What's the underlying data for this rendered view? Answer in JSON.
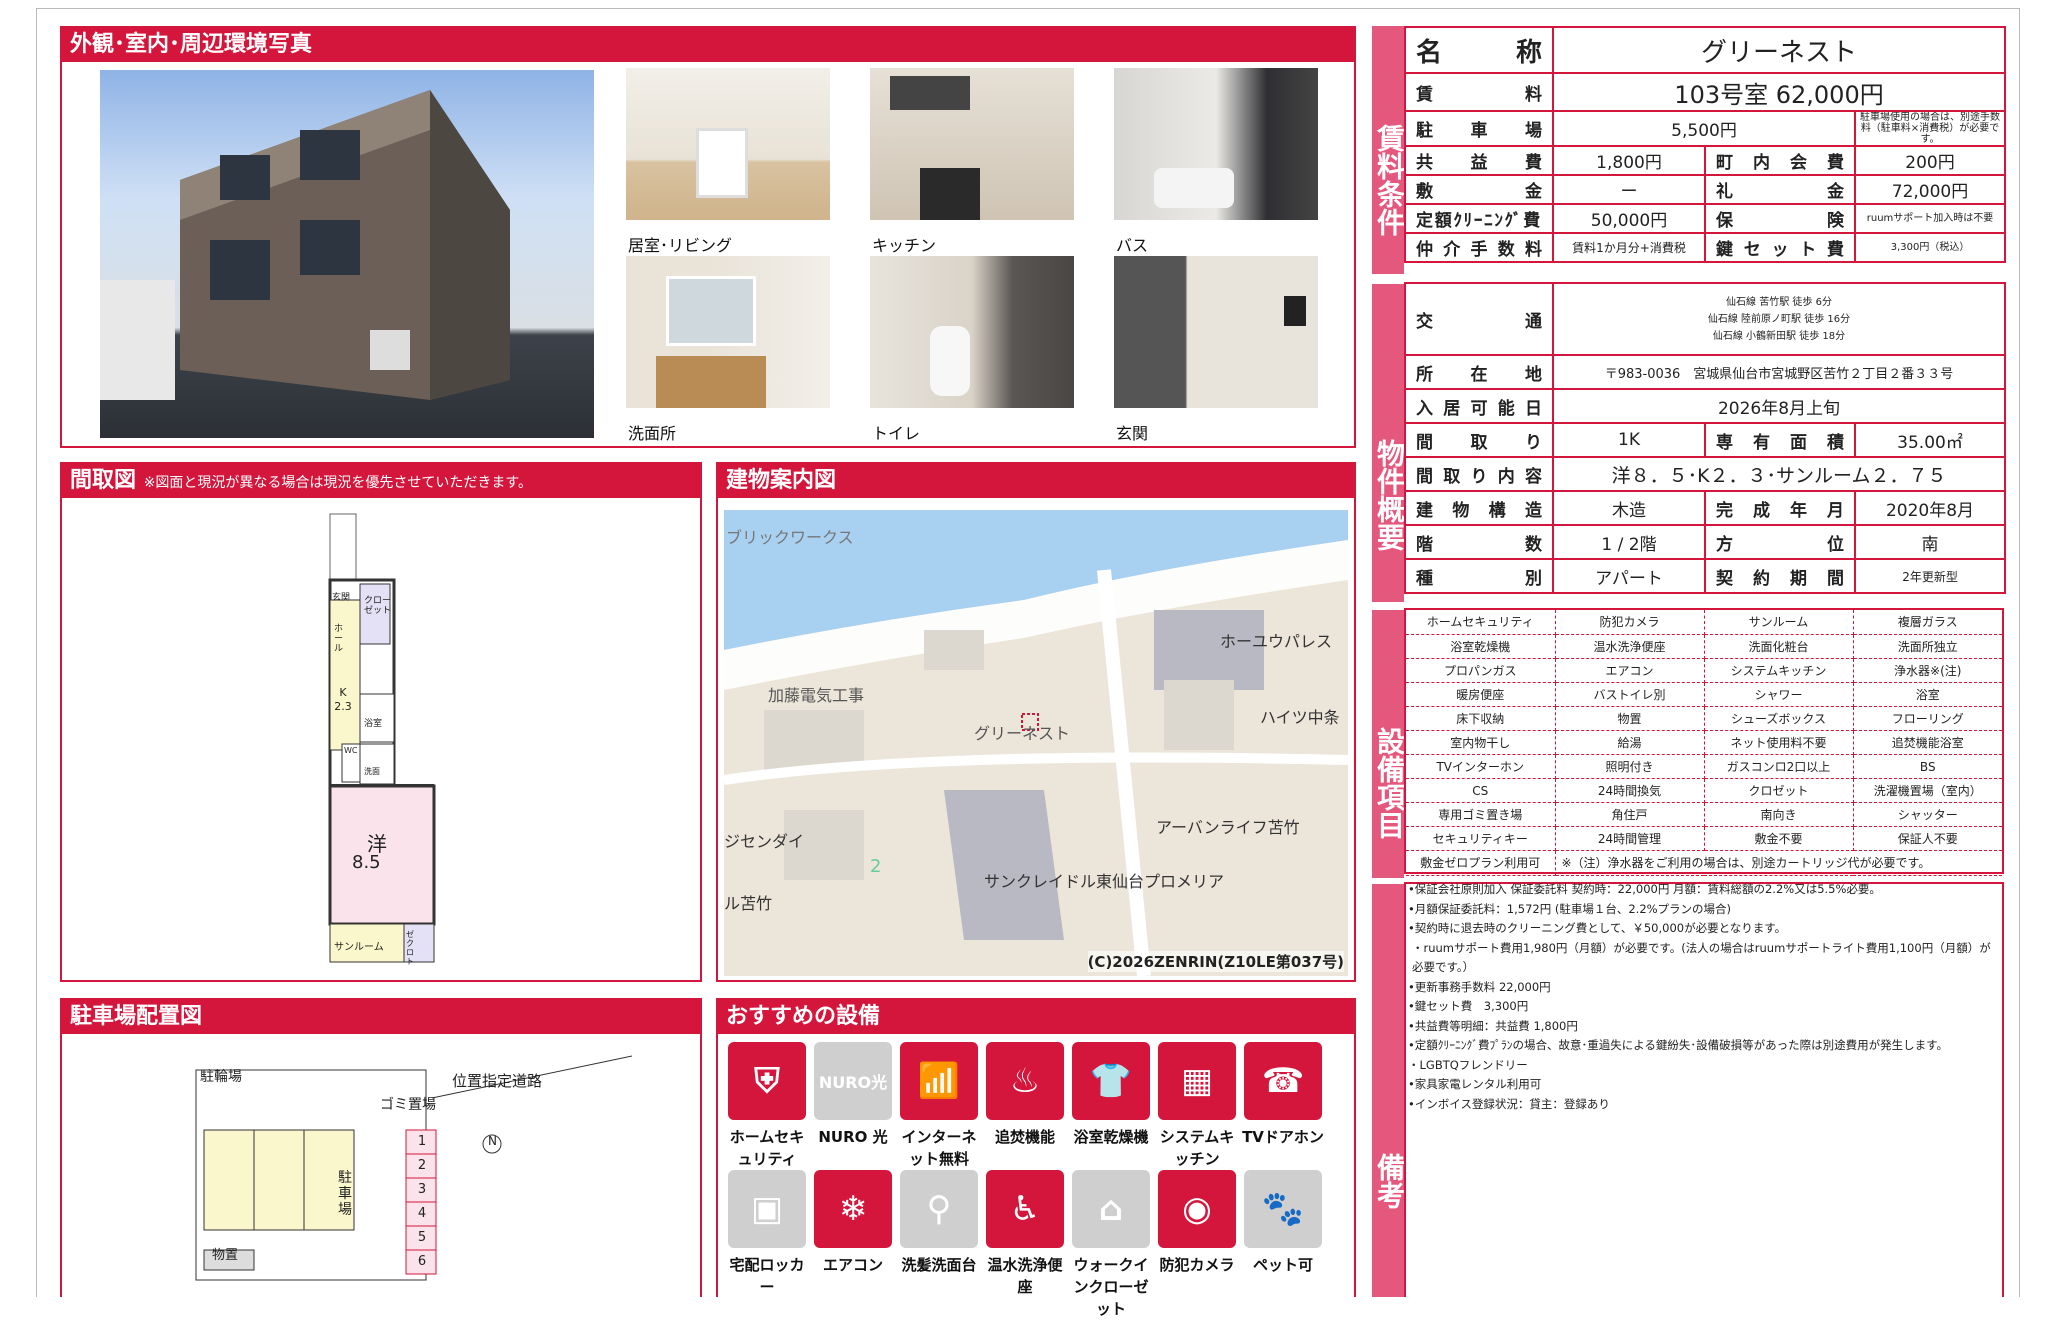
{
  "photos_panel": {
    "title": "外観･室内･周辺環境写真",
    "captions": [
      "居室･リビング",
      "キッチン",
      "バス",
      "洗面所",
      "トイレ",
      "玄関"
    ]
  },
  "floorplan_panel": {
    "title": "間取図",
    "note": "※図面と現況が異なる場合は現況を優先させていただきます。",
    "labels": {
      "entrance": "玄関",
      "closet": "クロー ゼット",
      "hall": "ホ ー ル",
      "kitchen": "K 2.3",
      "bath": "浴室",
      "wc": "WC",
      "washroom": "洗面",
      "room": "洋",
      "room_size": "8.5",
      "sunroom": "サンルーム",
      "small_closet": "ゼクロト"
    }
  },
  "map_panel": {
    "title": "建物案内図",
    "labels": [
      "ブリックワークス",
      "加藤電気工事",
      "グリーネスト",
      "ホーユウパレス",
      "ハイツ中条",
      "アーバンライフ苫竹",
      "ジセンダイ",
      "ル苫竹",
      "サンクレイドル東仙台プロメリア",
      "2"
    ],
    "copyright": "(C)2026ZENRIN(Z10LE第037号)"
  },
  "parking_panel": {
    "title": "駐車場配置図",
    "labels": {
      "bike": "駐輪場",
      "garbage": "ゴミ置場",
      "road": "位置指定道路",
      "parking": "駐 車 場",
      "storage": "物置",
      "north": "N"
    },
    "spaces": [
      "1",
      "2",
      "3",
      "4",
      "5",
      "6"
    ]
  },
  "recommend_panel": {
    "title": "おすすめの設備",
    "items": [
      {
        "label": "ホームセキュリティ",
        "icon": "shield-icon",
        "on": true
      },
      {
        "label": "NURO 光",
        "icon": "nuro-icon",
        "on": false
      },
      {
        "label": "インターネット無料",
        "icon": "wifi-icon",
        "on": true
      },
      {
        "label": "追焚機能",
        "icon": "bathtub-icon",
        "on": true
      },
      {
        "label": "浴室乾燥機",
        "icon": "bath-dryer-icon",
        "on": true
      },
      {
        "label": "システムキッチン",
        "icon": "kitchen-icon",
        "on": true
      },
      {
        "label": "TVドアホン",
        "icon": "tv-doorphone-icon",
        "on": true
      },
      {
        "label": "宅配ロッカー",
        "icon": "delivery-locker-icon",
        "on": false
      },
      {
        "label": "エアコン",
        "icon": "aircon-icon",
        "on": true
      },
      {
        "label": "洗髪洗面台",
        "icon": "vanity-icon",
        "on": false
      },
      {
        "label": "温水洗浄便座",
        "icon": "toilet-icon",
        "on": true
      },
      {
        "label": "ウォークインクローゼット",
        "icon": "closet-icon",
        "on": false
      },
      {
        "label": "防犯カメラ",
        "icon": "camera-icon",
        "on": true
      },
      {
        "label": "ペット可",
        "icon": "paw-icon",
        "on": false
      }
    ]
  },
  "sections": {
    "rent": "賃料条件",
    "property": "物件概要",
    "equipment": "設備項目",
    "remarks": "備考"
  },
  "rent": {
    "name_label": "名 称",
    "name": "グリーネスト",
    "rent_label": "賃 料",
    "rent": "103号室 62,000円",
    "parking_label": "駐 車 場",
    "parking": "5,500円",
    "parking_note": "駐車場使用の場合は、別途手数料（駐車料×消費税）が必要です。",
    "common_label": "共 益 費",
    "common": "1,800円",
    "town_label": "町 内 会 費",
    "town": "200円",
    "deposit_label": "敷 金",
    "deposit": "ー",
    "key_money_label": "礼 金",
    "key_money": "72,000円",
    "cleaning_label": "定額ｸﾘｰﾆﾝｸﾞ費",
    "cleaning": "50,000円",
    "insurance_label": "保 険",
    "insurance": "ruumサポート加入時は不要",
    "brokerage_label": "仲 介 手 数 料",
    "brokerage": "賃料1か月分+消費税",
    "keyset_label": "鍵 セ ッ ト 費",
    "keyset": "3,300円（税込）"
  },
  "property": {
    "transport_label": "交 通",
    "transport": [
      "仙石線 苦竹駅 徒歩 6分",
      "仙石線 陸前原ノ町駅 徒歩 16分",
      "仙石線 小鶴新田駅 徒歩 18分"
    ],
    "address_label": "所 在 地",
    "address": "〒983-0036　宮城県仙台市宮城野区苦竹２丁目２番３３号",
    "available_label": "入 居 可 能 日",
    "available": "2026年8月上旬",
    "layout_label": "間 取 り",
    "layout": "1K",
    "area_label": "専 有 面 積",
    "area": "35.00㎡",
    "detail_label": "間 取 り 内 容",
    "detail": "洋８．５･K２．３･サンルーム２．７５",
    "structure_label": "建 物 構 造",
    "structure": "木造",
    "built_label": "完 成 年 月",
    "built": "2020年8月",
    "floor_label": "階 数",
    "floor": "1 / 2階",
    "direction_label": "方 位",
    "direction": "南",
    "type_label": "種 別",
    "type": "アパート",
    "contract_label": "契 約 期 間",
    "contract": "2年更新型"
  },
  "equipment": [
    [
      "ホームセキュリティ",
      "防犯カメラ",
      "サンルーム",
      "複層ガラス"
    ],
    [
      "浴室乾燥機",
      "温水洗浄便座",
      "洗面化粧台",
      "洗面所独立"
    ],
    [
      "プロパンガス",
      "エアコン",
      "システムキッチン",
      "浄水器※(注)"
    ],
    [
      "暖房便座",
      "バストイレ別",
      "シャワー",
      "浴室"
    ],
    [
      "床下収納",
      "物置",
      "シューズボックス",
      "フローリング"
    ],
    [
      "室内物干し",
      "給湯",
      "ネット使用料不要",
      "追焚機能浴室"
    ],
    [
      "TVインターホン",
      "照明付き",
      "ガスコンロ2口以上",
      "BS"
    ],
    [
      "CS",
      "24時間換気",
      "クロゼット",
      "洗濯機置場（室内）"
    ],
    [
      "専用ゴミ置き場",
      "角住戸",
      "南向き",
      "シャッター"
    ],
    [
      "セキュリティキー",
      "24時間管理",
      "敷金不要",
      "保証人不要"
    ]
  ],
  "equipment_last": {
    "item": "敷金ゼロプラン利用可",
    "note": "※（注）浄水器をご利用の場合は、別途カートリッジ代が必要です。"
  },
  "remarks": [
    "•保証会社原則加入 保証委託料 契約時：22,000円 月額：賃料総額の2.2%又は5.5%必要。",
    "•月額保証委託料：1,572円 (駐車場１台、2.2%プランの場合)",
    "•契約時に退去時のクリーニング費として、￥50,000が必要となります。",
    "・ruumサポート費用1,980円（月額）が必要です。(法人の場合はruumサポートライト費用1,100円（月額）が必要です。）",
    "•更新事務手数料 22,000円",
    "•鍵セット費　3,300円",
    "•共益費等明細：共益費 1,800円",
    "•定額ｸﾘｰﾆﾝｸﾞ費ﾌﾟﾗﾝの場合、故意･重過失による鍵紛失･設備破損等があった際は別途費用が発生します。",
    "・LGBTQフレンドリー",
    "•家具家電レンタル利用可",
    "•インボイス登録状況：貸主：登録あり"
  ],
  "colors": {
    "accent": "#d5163c",
    "section_label": "#e5587e",
    "icon_off": "#cfcfcf"
  }
}
